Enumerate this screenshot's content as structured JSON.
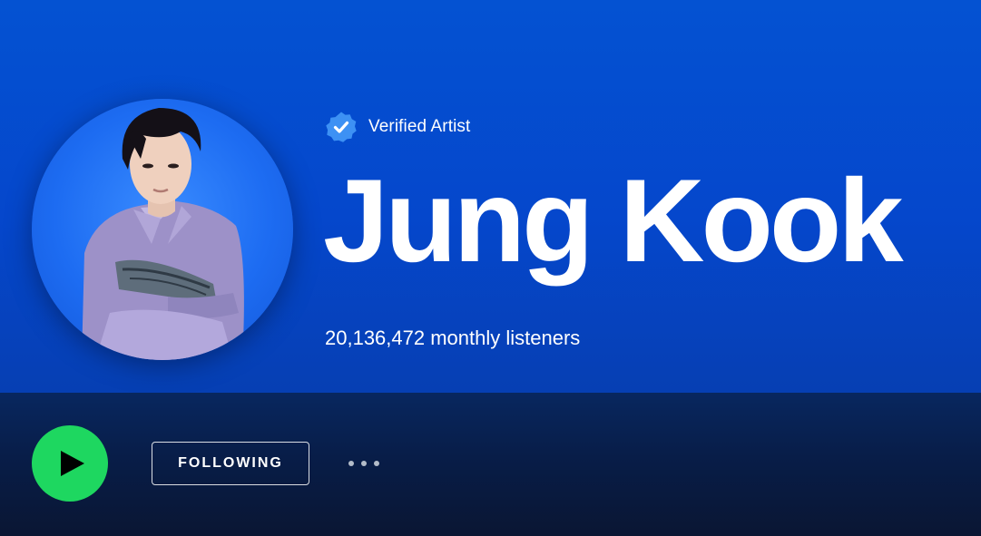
{
  "artist": {
    "verified_label": "Verified Artist",
    "name": "Jung Kook",
    "monthly_listeners": "20,136,472 monthly listeners"
  },
  "actions": {
    "play_icon": "play-icon",
    "following_label": "FOLLOWING",
    "more_icon": "more-options-icon"
  },
  "colors": {
    "header_blue": "#0452d2",
    "verified_badge": "#3d91f4",
    "play_green": "#1ed760",
    "action_bar": "#0a1633"
  }
}
